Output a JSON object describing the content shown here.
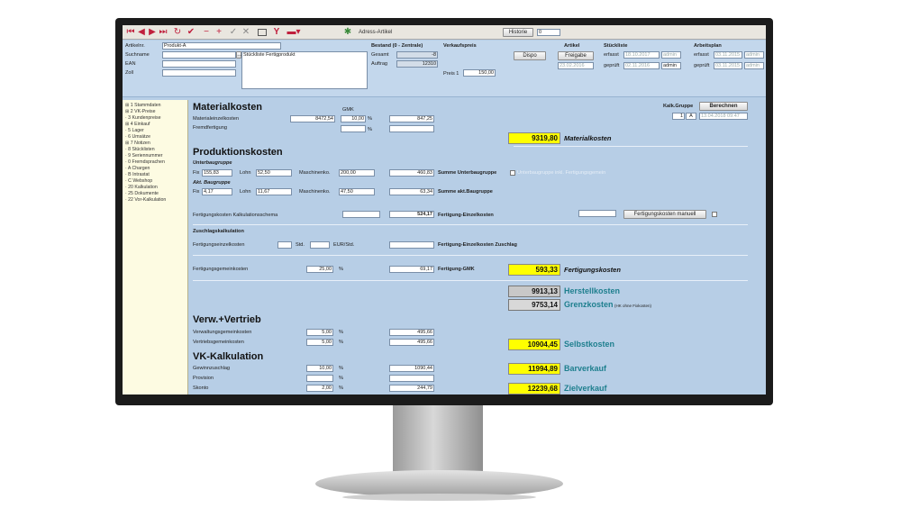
{
  "toolbar": {
    "first": "⏮",
    "prev": "◀",
    "next": "▶",
    "last": "⏭",
    "refresh": "↻",
    "check": "✔",
    "minus": "−",
    "plus": "+",
    "ok": "✓",
    "cancel": "✕",
    "adress_label": "Adress-Artikel",
    "historie_label": "Historie",
    "historie_value": "0"
  },
  "header": {
    "artikelnr_label": "Artikelnr.",
    "artikelnr_value": "Produkt-A",
    "suchname_label": "Suchname",
    "suchname_value": "Stückliste Fertigprodukt",
    "ean_label": "EAN",
    "zoll_label": "Zoll",
    "bestand_label": "Bestand (0 - Zentrale)",
    "gesamt_label": "Gesamt",
    "gesamt_value": "-8",
    "auftrag_label": "Auftrag",
    "auftrag_value": "12310",
    "verkaufspreis_label": "Verkaufspreis",
    "preis_label": "Preis 1",
    "preis_value": "150,00",
    "dispo_label": "Dispo",
    "artikel_label": "Artikel",
    "freigabe_label": "Freigabe",
    "artikel_date": "23.02.2016",
    "stueckliste_label": "Stückliste",
    "erfasst_label": "erfasst",
    "erfasst_date": "18.10.2017",
    "erfasst_user": "admin",
    "geprueft_label": "geprüft",
    "geprueft_date": "02.11.2016",
    "geprueft_user": "admin",
    "arbeitsplan_label": "Arbeitsplan",
    "ap_erfasst_label": "erfasst",
    "ap_erfasst_date": "03.11.2015",
    "ap_erfasst_user": "admin",
    "ap_geprueft_label": "geprüft",
    "ap_geprueft_date": "03.11.2015",
    "ap_geprueft_user": "admin"
  },
  "sidebar": {
    "items": [
      "⊞ 1 Stammdaten",
      "⊞ 2 VK-Preise",
      "· 3 Kundenpreise",
      "⊞ 4 Einkauf",
      "· 5 Lager",
      "· 6 Umsätze",
      "⊞ 7 Notizen",
      "· 8 Stücklisten",
      "· 9 Seriennummer",
      "· 0 Fremdsprachen",
      "· A Chargen",
      "· B Intrastat",
      "· C Webshop",
      "· 20 Kalkulation",
      "· 25 Dokumente",
      "· 22 Vor-Kalkulation"
    ]
  },
  "material": {
    "title": "Materialkosten",
    "gmk_label": "GMK",
    "einzel_label": "Materialeinzelkosten",
    "einzel_value": "8472,54",
    "gmk_value": "10,00",
    "pct": "%",
    "result_value": "847,25",
    "fremd_label": "Fremdfertigung",
    "total_value": "9319,80",
    "total_label": "Materialkosten",
    "kalk_gruppe_label": "Kalk.Gruppe",
    "berechnen_label": "Berechnen",
    "kalk_num": "1",
    "kalk_letter": "A",
    "kalk_date": "13.04.2018 09:47"
  },
  "produktion": {
    "title": "Produktionskosten",
    "unter_label": "Unterbaugruppe",
    "fix_label": "Fix",
    "fix1": "155,83",
    "lohn_label": "Lohn",
    "lohn1": "52,50",
    "maschinen_label": "Maschinenko.",
    "masch1": "200,00",
    "sum1": "460,83",
    "summe_unter_label": "Summe Unterbaugruppe",
    "unter_check_label": "Unterbaugruppe inkl. Fertigungsgemein",
    "akt_label": "Akt. Baugruppe",
    "fix2": "4,17",
    "lohn2": "11,67",
    "masch2": "47,50",
    "sum2": "63,34",
    "summe_akt_label": "Summe akt.Baugruppe",
    "schema_label": "Fertigungskosten Kalkulationsschema",
    "schema_value": "524,17",
    "fe_label": "Fertigung-Einzelkosten",
    "manuell_label": "Fertigungskosten manuell"
  },
  "zuschlag": {
    "title": "Zuschlagskalkulation",
    "fe_label": "Fertigungseinzelkosten",
    "std_label": "Std.",
    "eur_label": "EUR/Std.",
    "fez_label": "Fertigung-Einzelkosten Zuschlag",
    "fgk_label": "Fertigungsgemeinkosten",
    "fgk_pct": "25,00",
    "fgk_value": "69,17",
    "fgmk_label": "Fertigung-GMK",
    "fk_value": "593,33",
    "fk_label": "Fertigungskosten"
  },
  "totals": {
    "herstell_value": "9913,13",
    "herstell_label": "Herstellkosten",
    "grenz_value": "9753,14",
    "grenz_label": "Grenzkosten",
    "grenz_note": "(HK ohne Fixkosten)"
  },
  "verw": {
    "title": "Verw.+Vertrieb",
    "verwaltung_label": "Verwaltungsgemeinkosten",
    "verwaltung_pct": "5,00",
    "verwaltung_value": "495,66",
    "vertrieb_label": "Vertriebsgemeinkosten",
    "vertrieb_pct": "5,00",
    "vertrieb_value": "495,66",
    "selbst_value": "10904,45",
    "selbst_label": "Selbstkosten"
  },
  "vk": {
    "title": "VK-Kalkulation",
    "gewinn_label": "Gewinnzuschlag",
    "gewinn_pct": "10,00",
    "gewinn_value": "1090,44",
    "provision_label": "Provision",
    "skonto_label": "Skonto",
    "skonto_pct": "2,00",
    "skonto_value": "244,79",
    "bar_value": "11994,89",
    "bar_label": "Barverkauf",
    "ziel_value": "12239,68",
    "ziel_label": "Zielverkauf"
  },
  "colors": {
    "highlight": "#ffff00",
    "screen_bg": "#b7cee6",
    "sidebar_bg": "#fdfbe2",
    "teal": "#1e7f8e"
  }
}
